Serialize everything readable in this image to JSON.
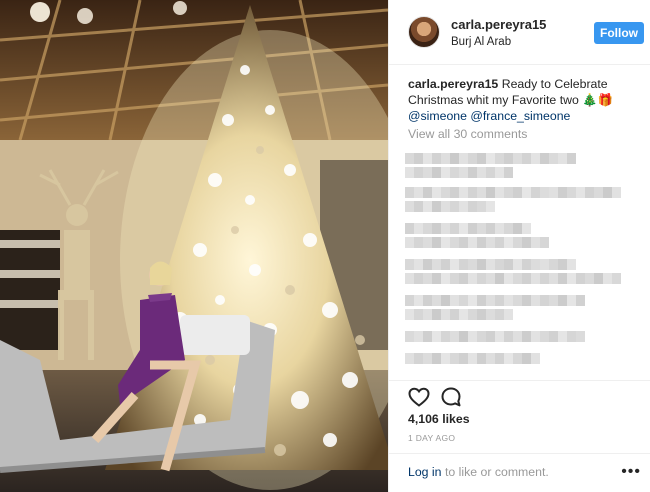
{
  "post": {
    "username": "carla.pereyra15",
    "location": "Burj Al Arab",
    "follow_label": "Follow",
    "caption": {
      "user": "carla.pereyra15",
      "text": "Ready to Celebrate Christmas whit my Favorite two",
      "emoji": "🎄🎁",
      "mention_1": "@simeone",
      "mention_2": "@france_simeone"
    },
    "view_comments": "View all 30 comments",
    "likes": "4,106 likes",
    "time_ago": "1 DAY AGO",
    "login_link": "Log in",
    "login_rest": "to like or comment.",
    "more_glyph": "•••"
  },
  "icons": {
    "like": "heart-icon",
    "comment": "comment-bubble-icon",
    "more": "more-options-icon"
  },
  "colors": {
    "follow_bg": "#3897f0",
    "link": "#003569",
    "muted": "#999999",
    "text": "#262626"
  }
}
